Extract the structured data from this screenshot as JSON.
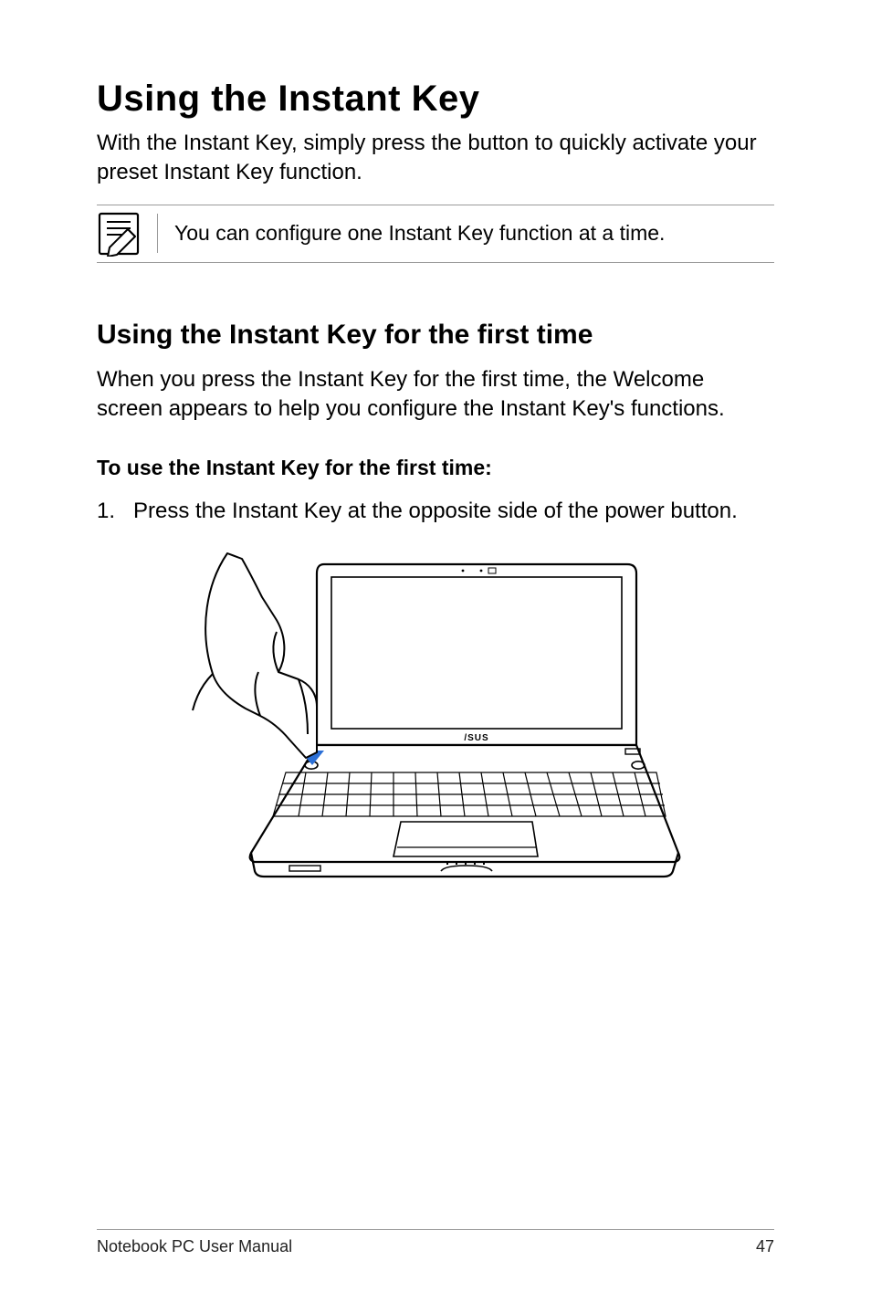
{
  "title": "Using the Instant Key",
  "intro": "With the Instant Key, simply press the button to quickly activate your preset Instant Key function.",
  "note": "You can configure one Instant Key function at a time.",
  "section_heading": "Using the Instant Key for the first time",
  "section_intro": "When you press the Instant Key for the first time,  the Welcome screen appears to help you configure the Instant Key's functions.",
  "procedure_lead": "To use the Instant Key for the first time:",
  "steps": [
    {
      "num": "1.",
      "text": "Press the Instant Key at the opposite side of the power button."
    }
  ],
  "footer_left": "Notebook PC User Manual",
  "footer_right": "47"
}
